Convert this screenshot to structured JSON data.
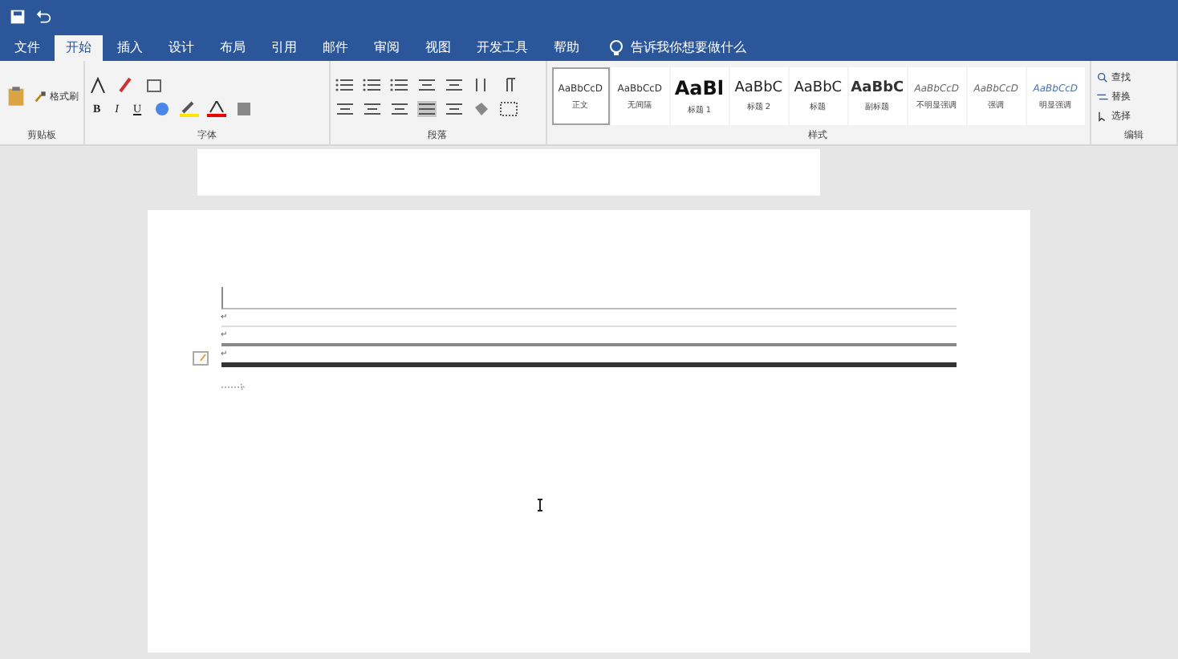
{
  "tabs": [
    {
      "label": "文件",
      "selected": false
    },
    {
      "label": "开始",
      "selected": true
    },
    {
      "label": "插入",
      "selected": false
    },
    {
      "label": "设计",
      "selected": false
    },
    {
      "label": "布局",
      "selected": false
    },
    {
      "label": "引用",
      "selected": false
    },
    {
      "label": "邮件",
      "selected": false
    },
    {
      "label": "审阅",
      "selected": false
    },
    {
      "label": "视图",
      "selected": false
    },
    {
      "label": "开发工具",
      "selected": false
    },
    {
      "label": "帮助",
      "selected": false
    }
  ],
  "search": {
    "placeholder": "告诉我你想要做什么"
  },
  "clipboard": {
    "button": "格式刷",
    "label": "剪贴板"
  },
  "font": {
    "buttons": [
      "B",
      "I",
      "U"
    ],
    "label": "字体"
  },
  "paragraph": {
    "label": "段落"
  },
  "styles": {
    "label": "样式",
    "items": [
      {
        "preview": "AaBbCcD",
        "name": "正文",
        "kind": "plain",
        "selected": true
      },
      {
        "preview": "AaBbCcD",
        "name": "无间隔",
        "kind": "plain",
        "selected": false
      },
      {
        "preview": "AaBl",
        "name": "标题 1",
        "kind": "big",
        "selected": false
      },
      {
        "preview": "AaBbC",
        "name": "标题 2",
        "kind": "medium",
        "selected": false
      },
      {
        "preview": "AaBbC",
        "name": "标题",
        "kind": "medium",
        "selected": false
      },
      {
        "preview": "AaBbC",
        "name": "副标题",
        "kind": "bold",
        "selected": false
      },
      {
        "preview": "AaBbCcD",
        "name": "不明显强调",
        "kind": "italic",
        "selected": false
      },
      {
        "preview": "AaBbCcD",
        "name": "强调",
        "kind": "italic",
        "selected": false
      },
      {
        "preview": "AaBbCcD",
        "name": "明显强调",
        "kind": "accent",
        "selected": false
      }
    ]
  },
  "editing": {
    "label": "编辑",
    "buttons": [
      "查找",
      "替换",
      "选择"
    ]
  },
  "document": {
    "rows": [
      {
        "mark": "↵",
        "kind": "thin"
      },
      {
        "mark": "↵",
        "kind": "medium"
      },
      {
        "mark": "↵",
        "kind": "thick"
      }
    ]
  }
}
